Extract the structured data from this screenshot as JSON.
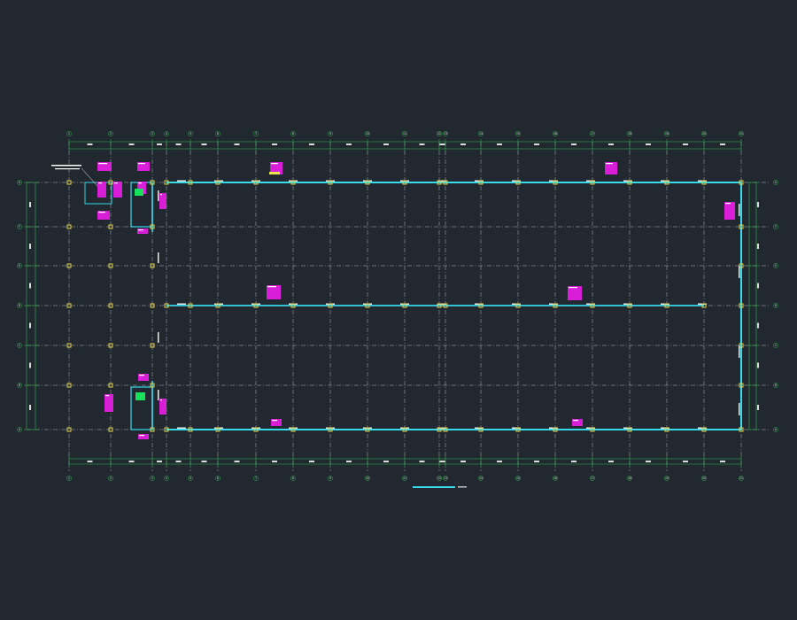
{
  "drawing": {
    "title": "",
    "scale": "",
    "note": "",
    "grid_x_labels": [
      "1",
      "2",
      "3",
      "4",
      "5",
      "6",
      "7",
      "8",
      "9",
      "10",
      "11",
      "12",
      "13",
      "14",
      "15",
      "16",
      "17",
      "18",
      "19",
      "20",
      "21",
      "22"
    ],
    "grid_y_labels": [
      "A",
      "B",
      "C",
      "D",
      "E",
      "F",
      "G"
    ],
    "colors": {
      "background": "#212830",
      "grid_line": "#e6e6e6",
      "dimension": "#2fb84a",
      "wall": "#37d9ea",
      "column": "#e2d14a",
      "tag": "#e41ee0",
      "fill": "#17e05a"
    }
  }
}
